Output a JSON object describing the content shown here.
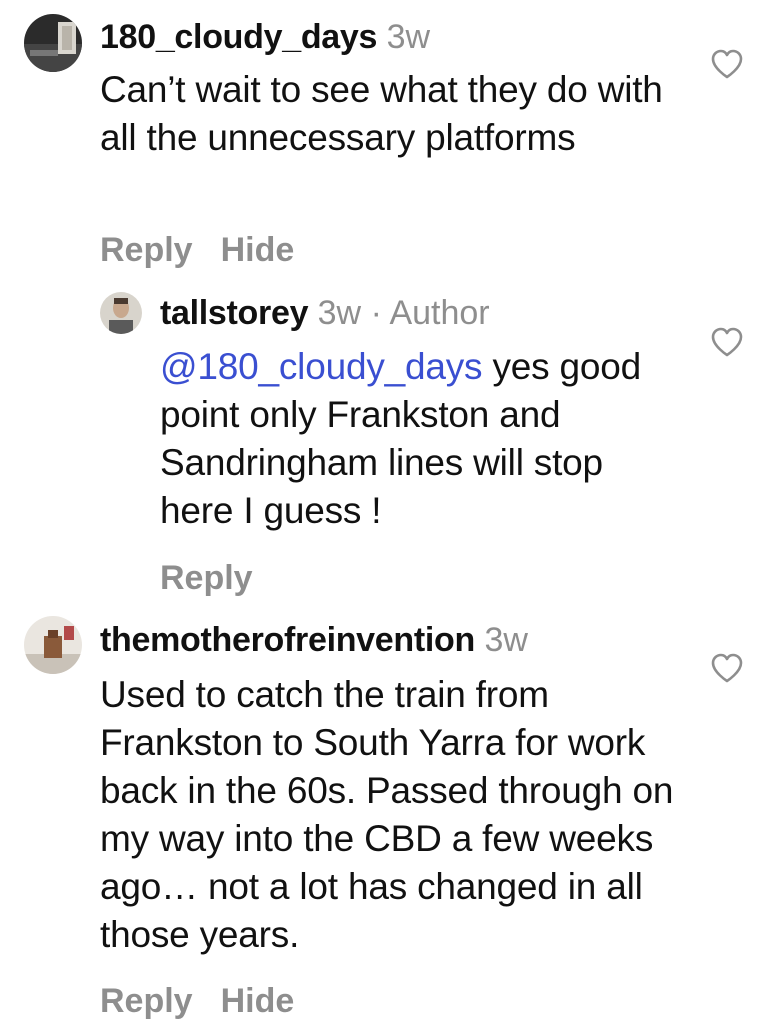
{
  "comments": [
    {
      "username": "180_cloudy_days",
      "time": "3w",
      "text": "Can’t wait to see what they do with all the unnecessary platforms",
      "actions": {
        "reply": "Reply",
        "hide": "Hide"
      },
      "icons": {
        "avatar": "avatar-image",
        "like": "heart-outline-icon"
      }
    },
    {
      "username": "tallstorey",
      "time": "3w",
      "author_tag": "· Author",
      "mention": "@180_cloudy_days",
      "text": "yes good point only Frankston and Sandringham lines will stop here I guess !",
      "actions": {
        "reply": "Reply"
      },
      "icons": {
        "avatar": "avatar-image",
        "like": "heart-outline-icon"
      }
    },
    {
      "username": "themotherofreinvention",
      "time": "3w",
      "text": "Used to catch the train from Frankston to South Yarra for work back in the 60s. Passed through on my way into the CBD a few weeks ago… not a lot has changed in all those years.",
      "actions": {
        "reply": "Reply",
        "hide": "Hide"
      },
      "icons": {
        "avatar": "avatar-image",
        "like": "heart-outline-icon"
      }
    }
  ],
  "colors": {
    "text": "#111111",
    "muted": "#8e8e8e",
    "mention": "#3a4fd1",
    "background": "#ffffff"
  }
}
